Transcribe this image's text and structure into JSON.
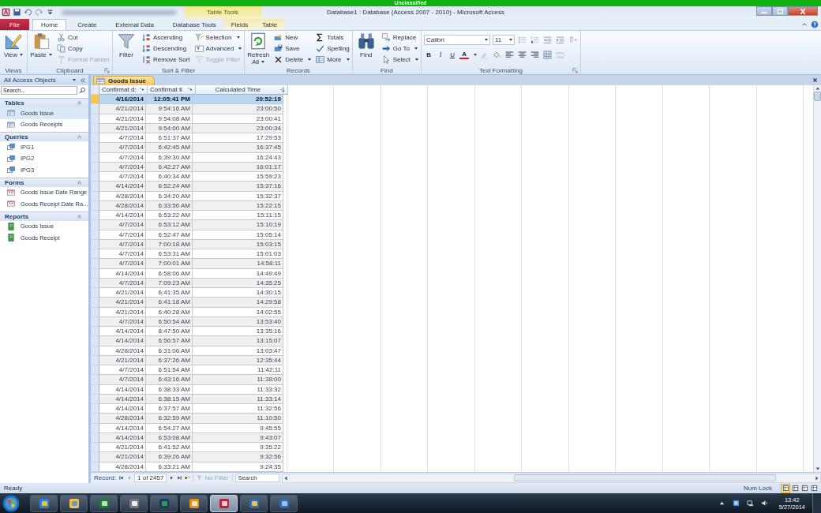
{
  "classification_banner": {
    "label": "Unclassified"
  },
  "window": {
    "title": "Database1 : Database (Access 2007 - 2010)  -  Microsoft Access",
    "context_group": "Table Tools"
  },
  "tabs": [
    {
      "label": "File",
      "kind": "file",
      "selected": false
    },
    {
      "label": "Home",
      "kind": "main",
      "selected": true
    },
    {
      "label": "Create",
      "kind": "main",
      "selected": false
    },
    {
      "label": "External Data",
      "kind": "main",
      "selected": false
    },
    {
      "label": "Database Tools",
      "kind": "main",
      "selected": false
    },
    {
      "label": "Fields",
      "kind": "context",
      "selected": false
    },
    {
      "label": "Table",
      "kind": "context",
      "selected": false
    }
  ],
  "ribbon": {
    "groups": [
      {
        "label": "Views",
        "kind": "buttons",
        "launcher": false,
        "columns": [
          [
            {
              "label": "View",
              "kind": "large",
              "dropdown": true,
              "disabled": false
            }
          ]
        ]
      },
      {
        "label": "Clipboard",
        "kind": "buttons",
        "launcher": true,
        "columns": [
          [
            {
              "label": "Paste",
              "kind": "large",
              "dropdown": true,
              "disabled": false
            }
          ],
          [
            {
              "label": "Cut",
              "kind": "small",
              "dropdown": false,
              "disabled": false
            },
            {
              "label": "Copy",
              "kind": "small",
              "dropdown": false,
              "disabled": false
            },
            {
              "label": "Format Painter",
              "kind": "small",
              "dropdown": false,
              "disabled": true
            }
          ]
        ]
      },
      {
        "label": "Sort & Filter",
        "kind": "buttons",
        "launcher": false,
        "columns": [
          [
            {
              "label": "Filter",
              "kind": "large",
              "dropdown": false,
              "disabled": false
            }
          ],
          [
            {
              "label": "Ascending",
              "kind": "small",
              "dropdown": false,
              "disabled": false
            },
            {
              "label": "Descending",
              "kind": "small",
              "dropdown": false,
              "disabled": false
            },
            {
              "label": "Remove Sort",
              "kind": "small",
              "dropdown": false,
              "disabled": false
            }
          ],
          [
            {
              "label": "Selection",
              "kind": "small",
              "dropdown": true,
              "disabled": false
            },
            {
              "label": "Advanced",
              "kind": "small",
              "dropdown": true,
              "disabled": false
            },
            {
              "label": "Toggle Filter",
              "kind": "small",
              "dropdown": false,
              "disabled": true
            }
          ]
        ]
      },
      {
        "label": "Records",
        "kind": "buttons",
        "launcher": false,
        "columns": [
          [
            {
              "label": "Refresh All",
              "kind": "large",
              "dropdown": true,
              "disabled": false
            }
          ],
          [
            {
              "label": "New",
              "kind": "small",
              "dropdown": false,
              "disabled": false
            },
            {
              "label": "Save",
              "kind": "small",
              "dropdown": false,
              "disabled": false
            },
            {
              "label": "Delete",
              "kind": "small",
              "dropdown": true,
              "disabled": false
            }
          ],
          [
            {
              "label": "Totals",
              "kind": "small",
              "dropdown": false,
              "disabled": false
            },
            {
              "label": "Spelling",
              "kind": "small",
              "dropdown": false,
              "disabled": false
            },
            {
              "label": "More",
              "kind": "small",
              "dropdown": true,
              "disabled": false
            }
          ]
        ]
      },
      {
        "label": "Find",
        "kind": "buttons",
        "launcher": false,
        "columns": [
          [
            {
              "label": "Find",
              "kind": "large",
              "dropdown": false,
              "disabled": false
            }
          ],
          [
            {
              "label": "Replace",
              "kind": "small",
              "dropdown": false,
              "disabled": false
            },
            {
              "label": "Go To",
              "kind": "small",
              "dropdown": true,
              "disabled": false
            },
            {
              "label": "Select",
              "kind": "small",
              "dropdown": true,
              "disabled": false
            }
          ]
        ]
      },
      {
        "label": "Text Formatting",
        "kind": "formatting",
        "launcher": true,
        "font": "Calibri",
        "font_size": "11",
        "format_buttons": [
          "B",
          "I",
          "U"
        ],
        "font_color_button": "A"
      }
    ]
  },
  "nav_pane": {
    "title": "All Access Objects",
    "search": {
      "placeholder": "Search..."
    },
    "groups": [
      {
        "label": "Tables",
        "kind": "table",
        "expanded": true,
        "items": [
          {
            "label": "Goods Issue",
            "selected": true
          },
          {
            "label": "Goods Receipts",
            "selected": false
          }
        ]
      },
      {
        "label": "Queries",
        "kind": "query",
        "expanded": true,
        "items": [
          {
            "label": "IPG1",
            "selected": false
          },
          {
            "label": "IPG2",
            "selected": false
          },
          {
            "label": "IPG3",
            "selected": false
          }
        ]
      },
      {
        "label": "Forms",
        "kind": "form",
        "expanded": true,
        "items": [
          {
            "label": "Goods Issue Date Range",
            "selected": false
          },
          {
            "label": "Goods Receipt Date Ra...",
            "selected": false
          }
        ]
      },
      {
        "label": "Reports",
        "kind": "report",
        "expanded": true,
        "items": [
          {
            "label": "Goods Issue",
            "selected": false
          },
          {
            "label": "Goods Receipt",
            "selected": false
          }
        ]
      }
    ]
  },
  "document_tab": {
    "label": "Goods Issue"
  },
  "datasheet": {
    "columns": [
      {
        "label": "Confirmat d:",
        "sorted": false
      },
      {
        "label": "Confirmat ti",
        "sorted": false
      },
      {
        "label": "Calculated Time",
        "sorted": true
      }
    ],
    "rows": [
      {
        "cells": [
          "4/16/2014",
          "12:05:41 PM",
          "20:52:19"
        ],
        "selected": true
      },
      {
        "cells": [
          "4/21/2014",
          "9:54:16 AM",
          "23:00:50"
        ],
        "selected": false
      },
      {
        "cells": [
          "4/21/2014",
          "9:54:08 AM",
          "23:00:41"
        ],
        "selected": false
      },
      {
        "cells": [
          "4/21/2014",
          "9:54:00 AM",
          "23:00:34"
        ],
        "selected": false
      },
      {
        "cells": [
          "4/7/2014",
          "6:51:37 AM",
          "17:29:53"
        ],
        "selected": false
      },
      {
        "cells": [
          "4/7/2014",
          "6:42:45 AM",
          "16:37:45"
        ],
        "selected": false
      },
      {
        "cells": [
          "4/7/2014",
          "6:39:30 AM",
          "16:24:43"
        ],
        "selected": false
      },
      {
        "cells": [
          "4/7/2014",
          "6:42:27 AM",
          "16:01:17"
        ],
        "selected": false
      },
      {
        "cells": [
          "4/7/2014",
          "6:40:34 AM",
          "15:59:23"
        ],
        "selected": false
      },
      {
        "cells": [
          "4/14/2014",
          "6:52:24 AM",
          "15:37:16"
        ],
        "selected": false
      },
      {
        "cells": [
          "4/28/2014",
          "6:34:20 AM",
          "15:32:37"
        ],
        "selected": false
      },
      {
        "cells": [
          "4/28/2014",
          "6:33:56 AM",
          "15:22:15"
        ],
        "selected": false
      },
      {
        "cells": [
          "4/14/2014",
          "6:53:22 AM",
          "15:11:15"
        ],
        "selected": false
      },
      {
        "cells": [
          "4/7/2014",
          "6:53:12 AM",
          "15:10:19"
        ],
        "selected": false
      },
      {
        "cells": [
          "4/7/2014",
          "6:52:47 AM",
          "15:05:14"
        ],
        "selected": false
      },
      {
        "cells": [
          "4/7/2014",
          "7:00:18 AM",
          "15:03:15"
        ],
        "selected": false
      },
      {
        "cells": [
          "4/7/2014",
          "6:53:31 AM",
          "15:01:03"
        ],
        "selected": false
      },
      {
        "cells": [
          "4/7/2014",
          "7:00:01 AM",
          "14:58:11"
        ],
        "selected": false
      },
      {
        "cells": [
          "4/14/2014",
          "6:58:06 AM",
          "14:49:49"
        ],
        "selected": false
      },
      {
        "cells": [
          "4/7/2014",
          "7:09:23 AM",
          "14:35:25"
        ],
        "selected": false
      },
      {
        "cells": [
          "4/21/2014",
          "6:41:35 AM",
          "14:30:15"
        ],
        "selected": false
      },
      {
        "cells": [
          "4/21/2014",
          "6:41:18 AM",
          "14:29:58"
        ],
        "selected": false
      },
      {
        "cells": [
          "4/21/2014",
          "6:40:28 AM",
          "14:02:55"
        ],
        "selected": false
      },
      {
        "cells": [
          "4/7/2014",
          "6:50:54 AM",
          "13:53:40"
        ],
        "selected": false
      },
      {
        "cells": [
          "4/14/2014",
          "8:47:50 AM",
          "13:35:16"
        ],
        "selected": false
      },
      {
        "cells": [
          "4/14/2014",
          "6:56:57 AM",
          "13:15:07"
        ],
        "selected": false
      },
      {
        "cells": [
          "4/28/2014",
          "6:31:06 AM",
          "13:03:47"
        ],
        "selected": false
      },
      {
        "cells": [
          "4/21/2014",
          "6:37:26 AM",
          "12:35:44"
        ],
        "selected": false
      },
      {
        "cells": [
          "4/7/2014",
          "6:51:54 AM",
          "11:42:11"
        ],
        "selected": false
      },
      {
        "cells": [
          "4/7/2014",
          "6:43:16 AM",
          "11:38:00"
        ],
        "selected": false
      },
      {
        "cells": [
          "4/14/2014",
          "6:38:33 AM",
          "11:33:32"
        ],
        "selected": false
      },
      {
        "cells": [
          "4/14/2014",
          "6:38:15 AM",
          "11:33:14"
        ],
        "selected": false
      },
      {
        "cells": [
          "4/14/2014",
          "6:37:57 AM",
          "11:32:56"
        ],
        "selected": false
      },
      {
        "cells": [
          "4/28/2014",
          "6:32:59 AM",
          "11:10:50"
        ],
        "selected": false
      },
      {
        "cells": [
          "4/14/2014",
          "6:54:27 AM",
          "9:45:55"
        ],
        "selected": false
      },
      {
        "cells": [
          "4/14/2014",
          "6:53:08 AM",
          "9:43:07"
        ],
        "selected": false
      },
      {
        "cells": [
          "4/21/2014",
          "6:41:52 AM",
          "9:35:22"
        ],
        "selected": false
      },
      {
        "cells": [
          "4/21/2014",
          "6:39:26 AM",
          "9:32:56"
        ],
        "selected": false
      },
      {
        "cells": [
          "4/28/2014",
          "6:33:21 AM",
          "9:24:35"
        ],
        "selected": false
      }
    ]
  },
  "record_navigator": {
    "label": "Record:",
    "position": "1 of 2457",
    "filter": {
      "label": "No Filter",
      "active": false
    },
    "search": {
      "placeholder": "Search"
    }
  },
  "status_bar": {
    "status": "Ready",
    "indicators": [
      "Num Lock"
    ],
    "view_buttons": [
      {
        "selected": true
      },
      {
        "selected": false
      },
      {
        "selected": false
      },
      {
        "selected": false
      }
    ]
  },
  "taskbar": {
    "apps": [
      {
        "selected": false
      },
      {
        "selected": false
      },
      {
        "selected": false
      },
      {
        "selected": false
      },
      {
        "selected": false
      },
      {
        "selected": false
      },
      {
        "selected": true
      },
      {
        "selected": false
      },
      {
        "selected": false
      }
    ],
    "clock": {
      "time": "13:42",
      "date": "5/27/2014"
    }
  }
}
